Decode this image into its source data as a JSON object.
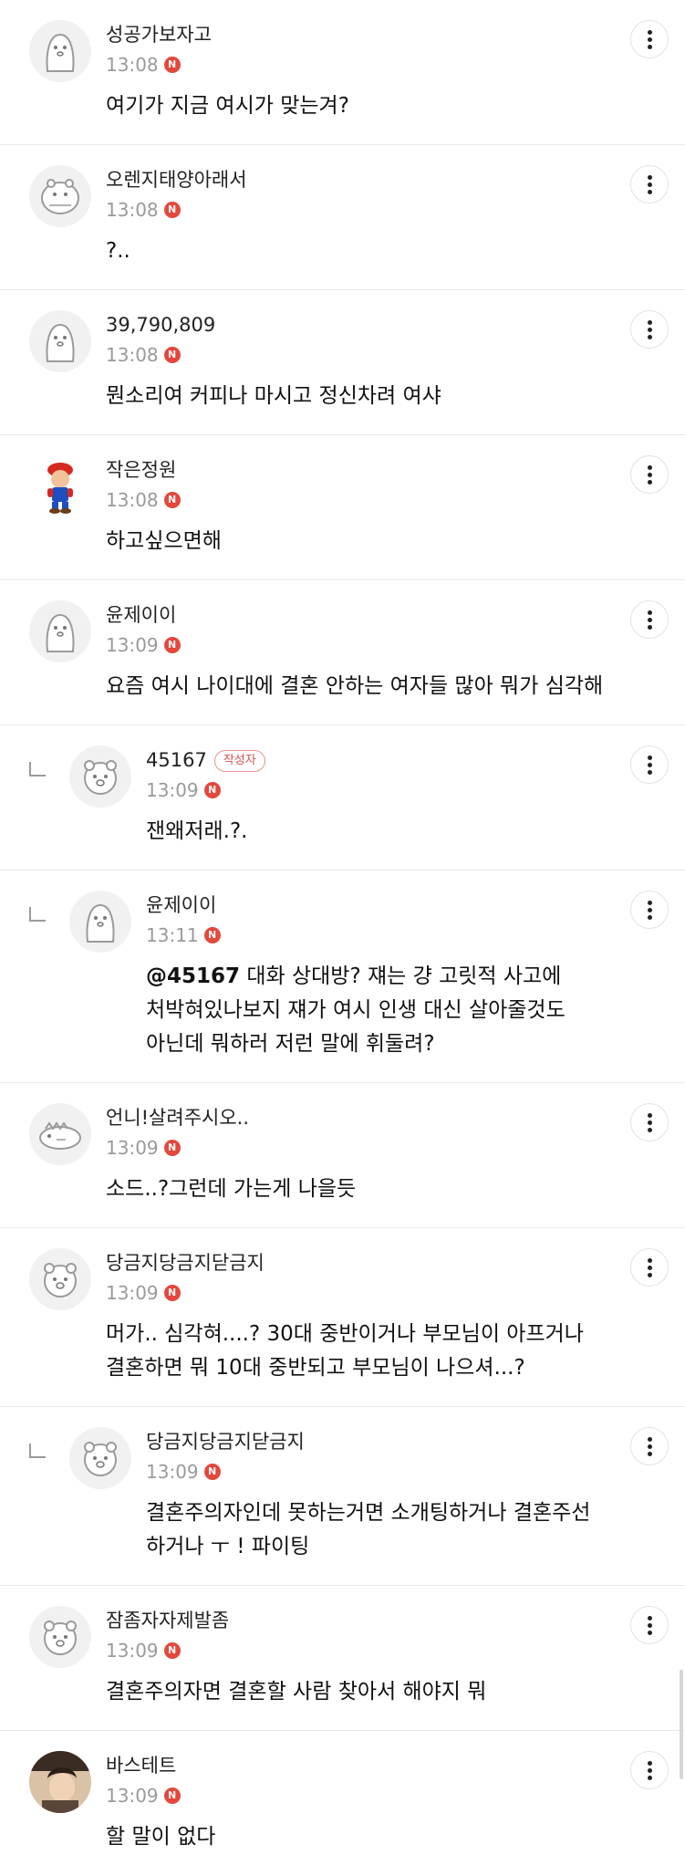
{
  "comments": [
    {
      "nick": "성공가보자고",
      "time": "13:08",
      "new": "N",
      "lines": [
        "여기가 지금 여시가 맞는겨?"
      ]
    },
    {
      "nick": "오렌지태양아래서",
      "time": "13:08",
      "new": "N",
      "lines": [
        "?.."
      ]
    },
    {
      "nick": "39,790,809",
      "time": "13:08",
      "new": "N",
      "lines": [
        "뭔소리여 커피나 마시고 정신차려 여샤"
      ]
    },
    {
      "nick": "작은정원",
      "time": "13:08",
      "new": "N",
      "lines": [
        "하고싶으면해"
      ]
    },
    {
      "nick": "윤제이이",
      "time": "13:09",
      "new": "N",
      "lines": [
        "요즘 여시 나이대에 결혼 안하는 여자들 많아 뭐가 심각해"
      ]
    },
    {
      "nick": "45167",
      "badge": "작성자",
      "time": "13:09",
      "new": "N",
      "lines": [
        "잰왜저래.?."
      ]
    },
    {
      "nick": "윤제이이",
      "time": "13:11",
      "new": "N",
      "mention": "@45167",
      "lines": [
        " 대화 상대방? 쟤는 걍 고릿적 사고에",
        "처박혀있나보지 쟤가 여시 인생 대신 살아줄것도",
        "아닌데 뭐하러 저런 말에 휘둘려?"
      ]
    },
    {
      "nick": "언니!살려주시오..",
      "time": "13:09",
      "new": "N",
      "lines": [
        "소드..?그런데 가는게 나을듯"
      ]
    },
    {
      "nick": "당금지당금지닫금지",
      "time": "13:09",
      "new": "N",
      "lines": [
        "머가.. 심각혀....? 30대 중반이거나 부모님이 아프거나",
        "결혼하면 뭐 10대 중반되고 부모님이 나으셔...?"
      ]
    },
    {
      "nick": "당금지당금지닫금지",
      "time": "13:09",
      "new": "N",
      "lines": [
        "결혼주의자인데 못하는거면 소개팅하거나 결혼주선",
        "하거나 ㅜ ! 파이팅"
      ]
    },
    {
      "nick": "잠좀자자제발좀",
      "time": "13:09",
      "new": "N",
      "lines": [
        "결혼주의자면 결혼할 사람 찾아서 해야지 뭐"
      ]
    },
    {
      "nick": "바스테트",
      "time": "13:09",
      "new": "N",
      "lines": [
        "할 말이 없다"
      ]
    }
  ]
}
